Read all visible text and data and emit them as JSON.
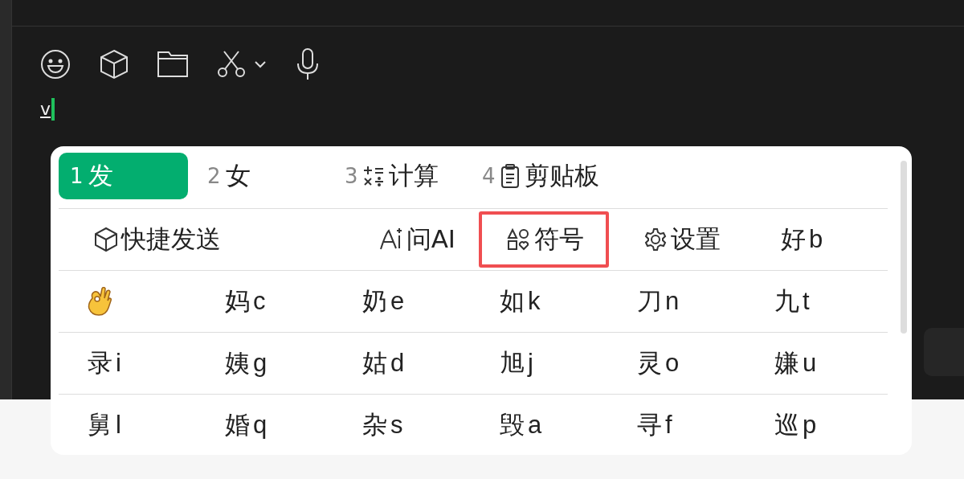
{
  "toolbar": [
    {
      "kind": "emoji"
    },
    {
      "kind": "cube"
    },
    {
      "kind": "folder"
    },
    {
      "kind": "scissors"
    },
    {
      "kind": "mic"
    }
  ],
  "input": {
    "value": "v"
  },
  "popup": {
    "tabs": [
      {
        "number": "1",
        "label": "发",
        "kind": "plain",
        "selected": true
      },
      {
        "number": "2",
        "label": "女",
        "kind": "plain",
        "selected": false
      },
      {
        "number": "3",
        "label": "计算",
        "kind": "calc",
        "selected": false
      },
      {
        "number": "4",
        "label": "剪贴板",
        "kind": "clipboard",
        "selected": false
      }
    ],
    "actions": [
      {
        "kind": "cube",
        "label": "快捷发送",
        "highlighted": false
      },
      {
        "kind": "ai",
        "label": "问AI",
        "highlighted": false
      },
      {
        "kind": "symbols",
        "label": "符号",
        "highlighted": true
      },
      {
        "kind": "settings",
        "label": "设置",
        "highlighted": false
      },
      {
        "kind": "candidate",
        "label": "好",
        "key": "b",
        "highlighted": false
      }
    ],
    "rows": [
      [
        {
          "kind": "emoji"
        },
        {
          "kind": "candidate",
          "char": "妈",
          "key": "c"
        },
        {
          "kind": "candidate",
          "char": "奶",
          "key": "e"
        },
        {
          "kind": "candidate",
          "char": "如",
          "key": "k"
        },
        {
          "kind": "candidate",
          "char": "刀",
          "key": "n"
        },
        {
          "kind": "candidate",
          "char": "九",
          "key": "t"
        }
      ],
      [
        {
          "kind": "candidate",
          "char": "录",
          "key": "i"
        },
        {
          "kind": "candidate",
          "char": "姨",
          "key": "g"
        },
        {
          "kind": "candidate",
          "char": "姑",
          "key": "d"
        },
        {
          "kind": "candidate",
          "char": "旭",
          "key": "j"
        },
        {
          "kind": "candidate",
          "char": "灵",
          "key": "o"
        },
        {
          "kind": "candidate",
          "char": "嫌",
          "key": "u"
        }
      ],
      [
        {
          "kind": "candidate",
          "char": "舅",
          "key": "l"
        },
        {
          "kind": "candidate",
          "char": "婚",
          "key": "q"
        },
        {
          "kind": "candidate",
          "char": "杂",
          "key": "s"
        },
        {
          "kind": "candidate",
          "char": "毁",
          "key": "a"
        },
        {
          "kind": "candidate",
          "char": "寻",
          "key": "f"
        },
        {
          "kind": "candidate",
          "char": "巡",
          "key": "p"
        }
      ]
    ]
  }
}
